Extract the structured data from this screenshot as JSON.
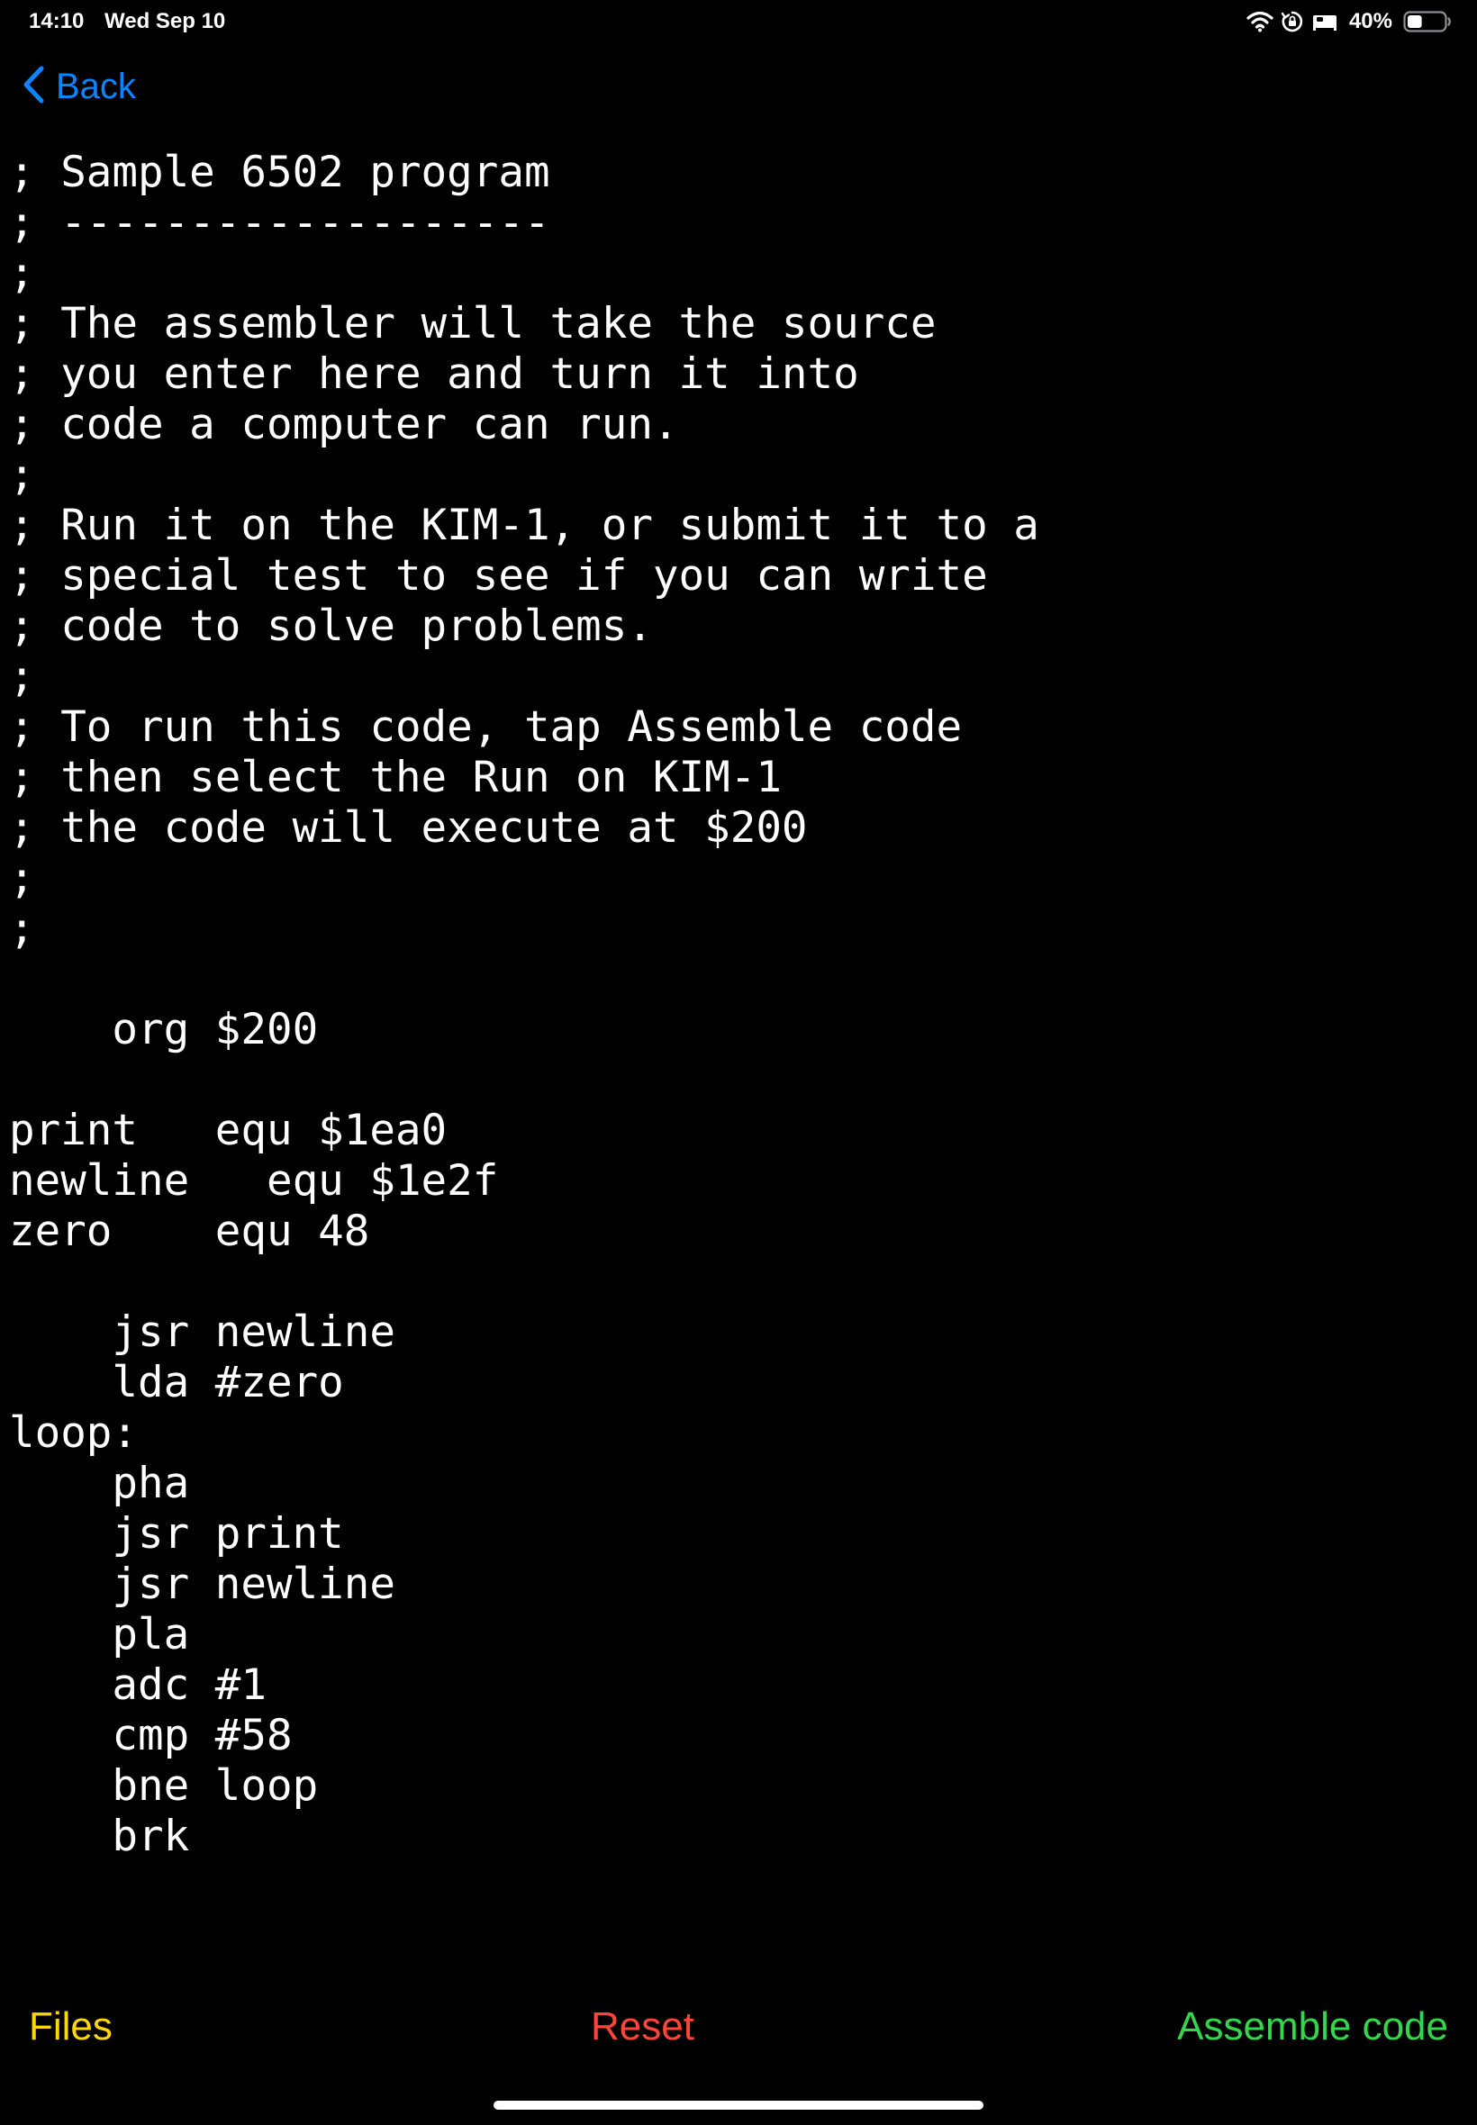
{
  "status_bar": {
    "time": "14:10",
    "date": "Wed Sep 10",
    "battery_percent": "40%",
    "battery_level": 0.4,
    "icons": [
      "wifi-icon",
      "orientation-lock-icon",
      "sleep-focus-icon",
      "battery-icon"
    ]
  },
  "nav": {
    "back_label": "Back",
    "back_icon": "chevron-left-icon"
  },
  "editor": {
    "source": "; Sample 6502 program\n; -------------------\n;\n; The assembler will take the source\n; you enter here and turn it into\n; code a computer can run.\n;\n; Run it on the KIM-1, or submit it to a\n; special test to see if you can write\n; code to solve problems.\n;\n; To run this code, tap Assemble code\n; then select the Run on KIM-1\n; the code will execute at $200\n;\n;\n\n    org $200\n\nprint   equ $1ea0\nnewline   equ $1e2f\nzero    equ 48\n\n    jsr newline\n    lda #zero\nloop:\n    pha\n    jsr print\n    jsr newline\n    pla\n    adc #1\n    cmp #58\n    bne loop\n    brk"
  },
  "toolbar": {
    "files_label": "Files",
    "reset_label": "Reset",
    "assemble_label": "Assemble code"
  },
  "colors": {
    "background": "#000000",
    "text": "#ffffff",
    "back_link": "#0a84ff",
    "files": "#ffd60a",
    "reset": "#ff453a",
    "assemble": "#32d74b"
  }
}
